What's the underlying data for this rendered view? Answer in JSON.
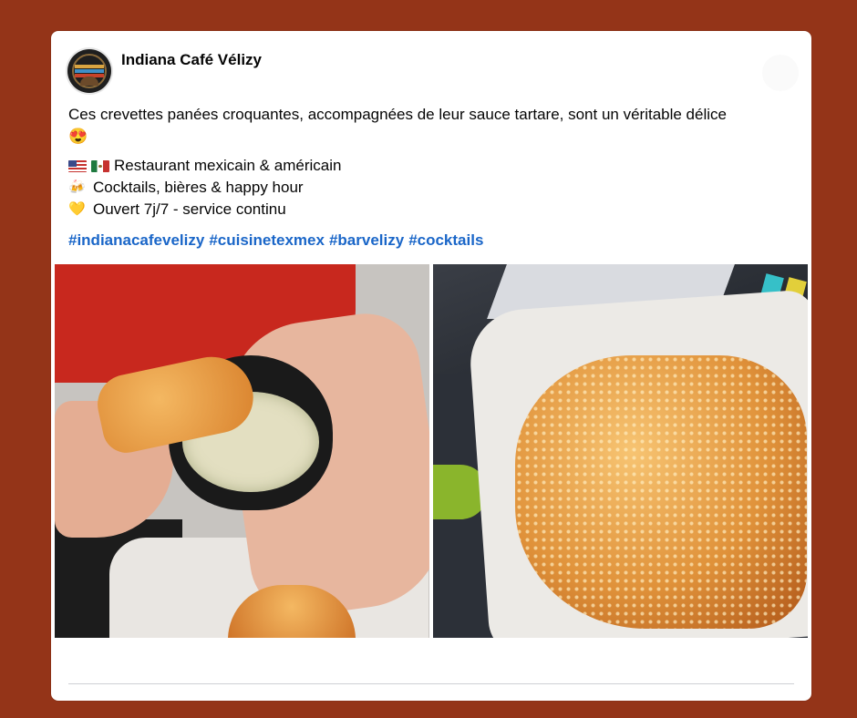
{
  "post": {
    "author": "Indiana Café Vélizy",
    "text": "Ces crevettes panées croquantes, accompagnées de leur sauce tartare, sont un véritable délice",
    "text_emoji": "😍",
    "features": [
      {
        "icon": "flags-us-mexico",
        "label": "Restaurant mexicain & américain"
      },
      {
        "icon": "beer-mugs-icon",
        "emoji": "🍻",
        "label": "Cocktails, bières & happy hour"
      },
      {
        "icon": "yellow-heart-icon",
        "emoji": "💛",
        "label": "Ouvert 7j/7 - service continu"
      }
    ],
    "hashtags": [
      "#indianacafevelizy",
      "#cuisinetexmex",
      "#barvelizy",
      "#cocktails"
    ]
  },
  "colors": {
    "background": "#943418",
    "hashtag": "#1a66c8",
    "text": "#050505"
  }
}
